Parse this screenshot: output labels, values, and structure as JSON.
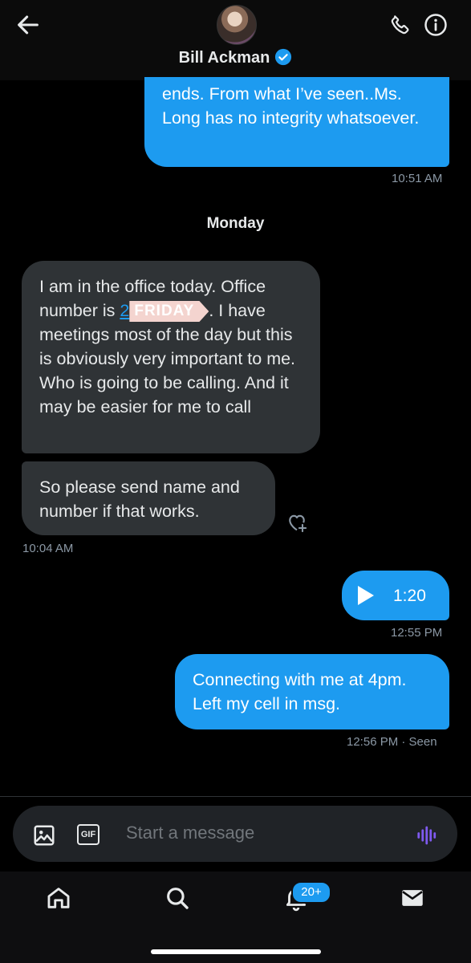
{
  "header": {
    "name": "Bill Ackman"
  },
  "messages": {
    "m1": {
      "text": "ends. From what I’ve seen..Ms. Long has no integrity whatsoever.",
      "time": "10:51 AM"
    },
    "day_separator": "Monday",
    "m2": {
      "before": "I am in the office today. Office number is ",
      "link_visible": "2",
      "redaction_label": "FRIDAY",
      "after": ". I have meetings most of the day but this is obviously very important to me. Who is going to be calling. And it may be easier for me to call"
    },
    "m3": {
      "text": "So please send name and number if that works.",
      "time": "10:04 AM"
    },
    "m4": {
      "duration": "1:20",
      "time": "12:55 PM"
    },
    "m5": {
      "text": "Connecting with me at 4pm. Left my cell in msg.",
      "meta": "12:56 PM · Seen"
    }
  },
  "composer": {
    "placeholder": "Start a message",
    "gif_label": "GIF"
  },
  "nav": {
    "notifications_badge": "20+"
  },
  "colors": {
    "accent": "#1d9bf0",
    "received_bubble": "#2f3336",
    "background": "#000000",
    "voice_icon": "#7f5af0"
  },
  "icons": [
    "back-arrow-icon",
    "verified-badge-icon",
    "phone-icon",
    "info-icon",
    "add-reaction-icon",
    "play-icon",
    "image-icon",
    "gif-icon",
    "voice-wave-icon",
    "home-icon",
    "search-icon",
    "notifications-bell-icon",
    "messages-envelope-icon"
  ]
}
